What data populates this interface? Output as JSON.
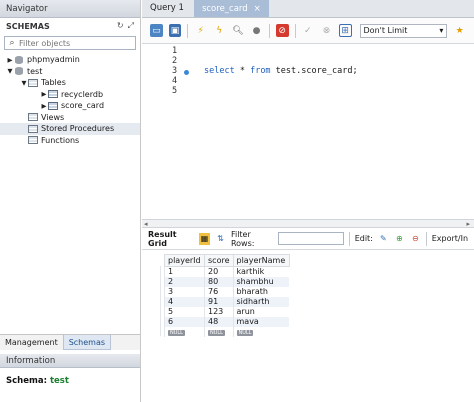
{
  "navigator": {
    "title": "Navigator",
    "schemas_label": "SCHEMAS",
    "filter_placeholder": "Filter objects",
    "tree": [
      {
        "label": "phpmyadmin"
      },
      {
        "label": "test"
      },
      {
        "label": "Tables"
      },
      {
        "label": "recyclerdb"
      },
      {
        "label": "score_card"
      },
      {
        "label": "Views"
      },
      {
        "label": "Stored Procedures"
      },
      {
        "label": "Functions"
      }
    ],
    "tabs": [
      "Management",
      "Schemas"
    ],
    "info_title": "Information",
    "schema_key": "Schema:",
    "schema_value": "test"
  },
  "editor": {
    "tabs": [
      "Query 1",
      "score_card"
    ],
    "limit_label": "Don't Limit",
    "line_numbers": [
      "1",
      "2",
      "3",
      "4",
      "5"
    ],
    "query": {
      "kw1": "select",
      "rest1": " * ",
      "kw2": "from",
      "rest2": " test.score_card;"
    }
  },
  "result": {
    "grid_label": "Result Grid",
    "filter_label": "Filter Rows:",
    "edit_label": "Edit:",
    "export_label": "Export/In",
    "columns": [
      "playerId",
      "score",
      "playerName"
    ],
    "rows": [
      [
        "1",
        "20",
        "karthik"
      ],
      [
        "2",
        "80",
        "shambhu"
      ],
      [
        "3",
        "76",
        "bharath"
      ],
      [
        "4",
        "91",
        "sidharth"
      ],
      [
        "5",
        "123",
        "arun"
      ],
      [
        "6",
        "48",
        "mava"
      ]
    ],
    "null_label": "NULL"
  }
}
